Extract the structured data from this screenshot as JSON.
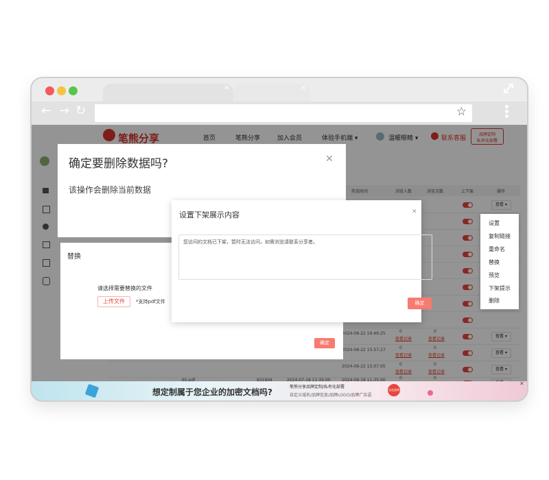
{
  "site": {
    "logo_text": "笔熊分享",
    "nav": [
      "首页",
      "笔熊分享",
      "加入会员",
      "体验手机端 ▾"
    ],
    "user_name": "温暖眼睛 ▾",
    "contact": "联系客服",
    "badge_line1": "品牌定制",
    "badge_line2": "私有化部署"
  },
  "table": {
    "headers": [
      "失效时间",
      "浏览人数",
      "浏览次数",
      "上下架",
      "操作"
    ],
    "view_label": "查看 ▾",
    "link_label": "查看记录",
    "rows": [
      {
        "date": "2024-08-22 16:46:25",
        "visitors": "0",
        "visits": "0"
      },
      {
        "date": "2024-08-22 15:57:27",
        "visitors": "0",
        "visits": "0"
      },
      {
        "date": "2024-08-22 15:07:05",
        "visitors": "0",
        "visits": "0"
      },
      {
        "name": "65.pdf",
        "size": "831604",
        "created": "2024-07-18 11:35:00",
        "date": "2024-08-18 11:35:00",
        "visitors": "0",
        "visits": "0"
      }
    ]
  },
  "dialog_delete": {
    "title": "确定要删除数据吗?",
    "message": "该操作会删除当前数据"
  },
  "dialog_replace": {
    "title": "替换",
    "prompt": "请选择需要替换的文件",
    "upload_label": "上传文件",
    "hint": "*支持pdf文件",
    "confirm_label": "确定"
  },
  "dialog_offline": {
    "title": "设置下架展示内容",
    "textarea_value": "您访问的文档已下架，暂时无法访问，如需浏览请联系分享者。",
    "confirm_label": "确定"
  },
  "context_menu": [
    "设置",
    "复制链接",
    "重命名",
    "替换",
    "预览",
    "下架提示",
    "删除"
  ],
  "banner": {
    "headline": "想定制属于您企业的加密文档吗?",
    "line1": "笔熊分享品牌定制/私有化部署",
    "line2": "自定义域名/品牌信息/品牌LOGO/品牌广告语",
    "badge": "点击咨询"
  },
  "colors": {
    "accent_red": "#e8453c",
    "button_red": "#f77b70",
    "dot_red": "#f15b5b",
    "dot_yellow": "#f5c242",
    "dot_green": "#57c74b"
  }
}
